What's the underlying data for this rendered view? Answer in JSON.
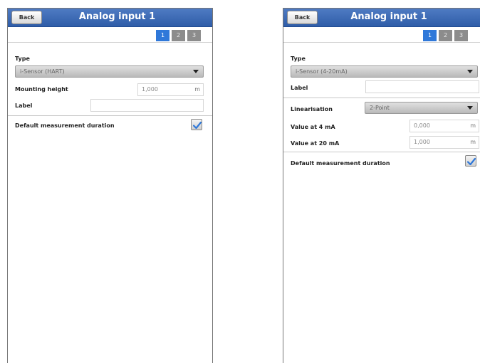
{
  "left": {
    "back_label": "Back",
    "title": "Analog input 1",
    "tabs": [
      "1",
      "2",
      "3"
    ],
    "type_label": "Type",
    "type_value": "i-Sensor (HART)",
    "mounting_label": "Mounting height",
    "mounting_value": "1,000",
    "mounting_unit": "m",
    "label_label": "Label",
    "label_value": "",
    "default_label": "Default measurement duration",
    "default_checked": true
  },
  "right": {
    "back_label": "Back",
    "title": "Analog input 1",
    "tabs": [
      "1",
      "2",
      "3"
    ],
    "type_label": "Type",
    "type_value": "i-Sensor (4-20mA)",
    "label_label": "Label",
    "label_value": "",
    "linearisation_label": "Linearisation",
    "linearisation_value": "2-Point",
    "value4_label": "Value at 4 mA",
    "value4_value": "0,000",
    "value4_unit": "m",
    "value20_label": "Value at 20 mA",
    "value20_value": "1,000",
    "value20_unit": "m",
    "default_label": "Default measurement duration",
    "default_checked": true
  },
  "colors": {
    "titlebar": "#2f5da8",
    "tab_active": "#2f78d9",
    "tab_inactive": "#8c8c8c",
    "checkmark": "#2f78d9"
  }
}
